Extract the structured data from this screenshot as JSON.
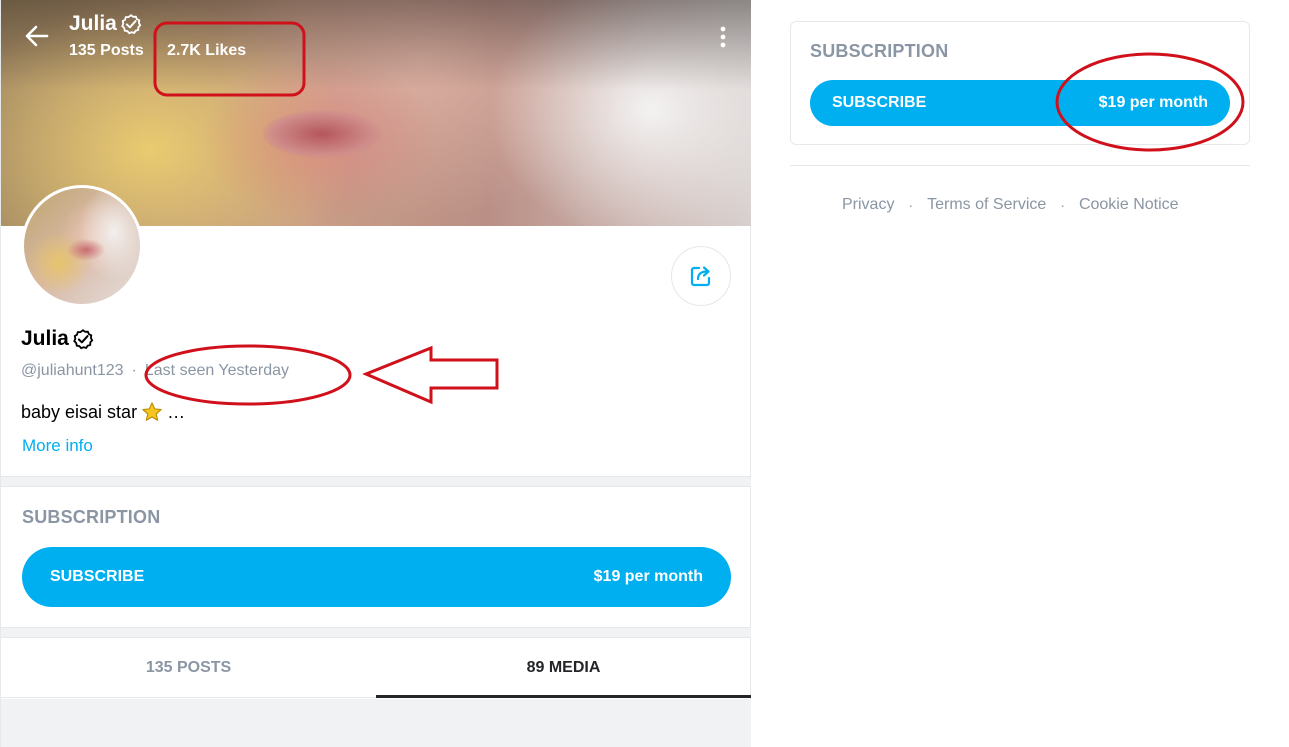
{
  "header": {
    "title": "Julia",
    "posts": "135 Posts",
    "likes": "2.7K Likes",
    "separator": "·"
  },
  "profile": {
    "name": "Julia",
    "username": "@juliahunt123",
    "meta_separator": "·",
    "last_seen": "Last seen Yesterday",
    "bio": "baby eisai star",
    "bio_emoji": "⭐",
    "bio_ellipsis": "…",
    "more_info": "More info"
  },
  "subscription": {
    "heading": "SUBSCRIPTION",
    "button_label": "SUBSCRIBE",
    "price": "$19 per month"
  },
  "tabs": [
    {
      "label": "135 POSTS",
      "active": false
    },
    {
      "label": "89 MEDIA",
      "active": true
    }
  ],
  "sidebar": {
    "heading": "SUBSCRIPTION",
    "button_label": "SUBSCRIBE",
    "price": "$19 per month"
  },
  "footer": {
    "links": [
      "Privacy",
      "Terms of Service",
      "Cookie Notice"
    ],
    "separator": "·"
  },
  "colors": {
    "accent": "#00aff0",
    "muted_text": "#8a96a3",
    "annotation_red": "#d0111b"
  },
  "icons": [
    "back-arrow-icon",
    "verified-check-icon",
    "more-vertical-icon",
    "share-icon",
    "star-emoji-icon"
  ]
}
